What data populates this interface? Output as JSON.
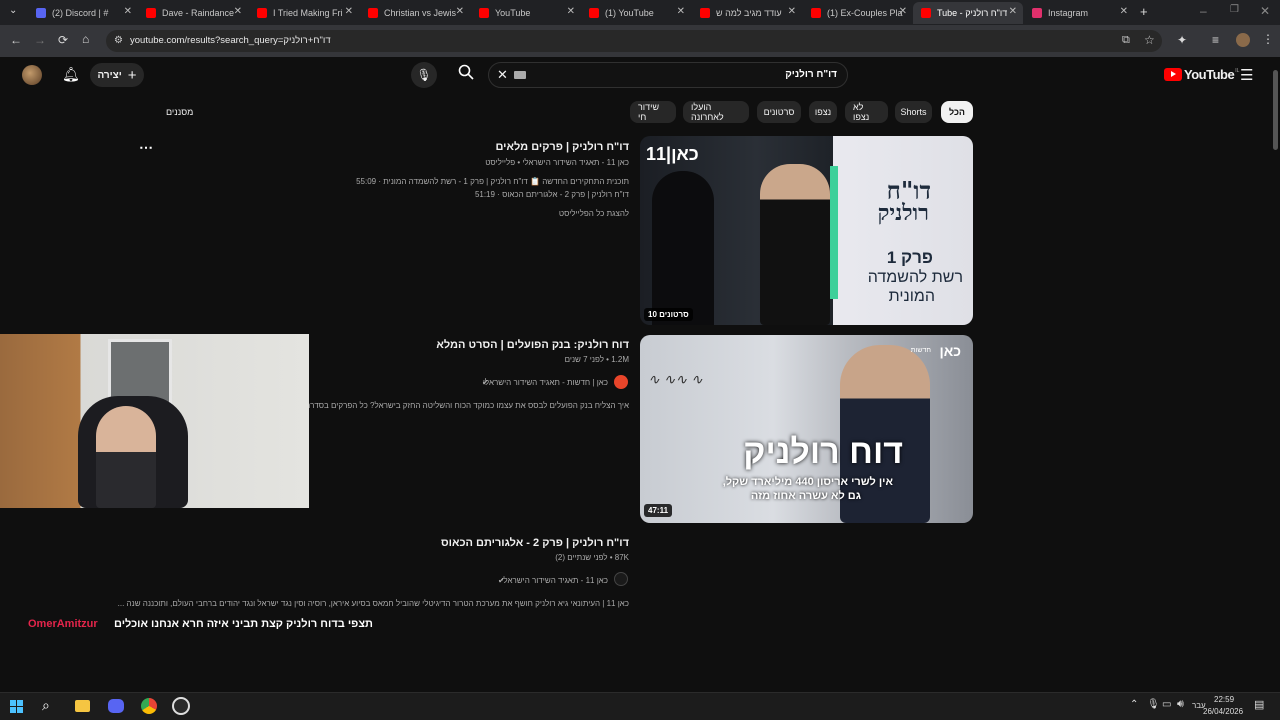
{
  "browser": {
    "tabs": [
      {
        "label": "(2) Discord | #",
        "color": "#5865f2"
      },
      {
        "label": "Dave - Raindance",
        "color": "#ff0000"
      },
      {
        "label": "I Tried Making Fri",
        "color": "#ff0000"
      },
      {
        "label": "Christian vs Jewis",
        "color": "#ff0000"
      },
      {
        "label": "YouTube",
        "color": "#ff0000"
      },
      {
        "label": "(1) YouTube",
        "color": "#ff0000"
      },
      {
        "label": "עודד מגיב למה ש",
        "color": "#ff0000"
      },
      {
        "label": "(1) Ex-Couples Pla",
        "color": "#ff0000"
      },
      {
        "label": "Tube - דו\"ח רולניק",
        "color": "#ff0000"
      },
      {
        "label": "Instagram",
        "color": "#e1306c"
      }
    ],
    "url": "youtube.com/results?search_query=דו\"ח+רולניק"
  },
  "youtube": {
    "logo_text": "YouTube",
    "logo_sup": "IL",
    "search_value": "דו\"ח רולניק",
    "create_label": "יצירה",
    "filters_label": "מסננים",
    "chips": [
      "הכל",
      "Shorts",
      "לא נצפו",
      "נצפו",
      "סרטונים",
      "הועלו לאחרונה",
      "שידור חי"
    ],
    "results": [
      {
        "title": "דו\"ח רולניק | פרקים מלאים",
        "channel_line": "כאן 11 - תאגיד השידור הישראלי • פלייליסט",
        "line1": "תוכנית התחקירים החדשה 📋 דו\"ח רולניק | פרק 1 - רשת להשמדה המונית · 55:09",
        "line2": "דו\"ח רולניק | פרק 2 - אלגוריתם הכאוס · 51:19",
        "link": "להצגת כל הפלייליסט",
        "badge": "10 סרטונים",
        "thumb_logo": "כאן|11",
        "thumb_title1": "דו\"ח",
        "thumb_title2": "רולניק",
        "thumb_ep": "פרק 1",
        "thumb_sub1": "רשת להשמדה",
        "thumb_sub2": "המונית"
      },
      {
        "title": "דוח רולניק: בנק הפועלים | הסרט המלא",
        "views": "1.2M • לפני 7 שנים",
        "channel": "כאן | חדשות - תאגיד השידור הישראלי",
        "desc": "איך הצליח בנק הפועלים לבסס את עצמו כמוקד הכוח והשליטה החזק בישראל? כל הפרקים בסדרת התחקירים",
        "duration": "47:11",
        "thumb_logo": "כאן",
        "thumb_logo_sub": "חדשות",
        "thumb_title": "דוח רולניק",
        "thumb_sub1": "אין לשרי אריסון 440 מיליארד שקל,",
        "thumb_sub2": "גם לא עשרה אחוז מזה"
      },
      {
        "title": "דו\"ח רולניק | פרק 2 - אלגוריתם הכאוס",
        "views": "87K • לפני שנתיים (2)",
        "channel": "כאן 11 - תאגיד השידור הישראלי",
        "desc": "כאן 11 | העיתונאי גיא רולניק חושף את מערכת הטרור הדיגיטלי שהוביל חמאס בסיוע איראן, רוסיה וסין נגד ישראל ונגד יהודים ברחבי העולם, ותוכננה שנה ..."
      }
    ]
  },
  "overlay": {
    "username": "OmerAmitzur",
    "caption": "תצפי בדוח רולניק קצת תביני איזה חרא אנחנו אוכלים"
  },
  "taskbar": {
    "lang": "עבר",
    "time": "22:59",
    "date": "26/04/2026"
  }
}
